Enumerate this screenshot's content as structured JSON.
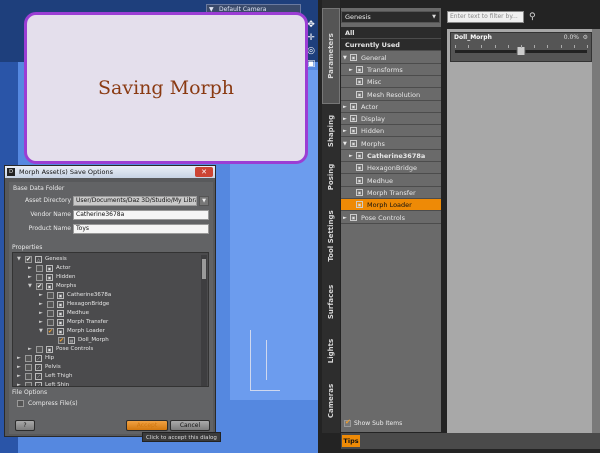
{
  "viewport": {
    "camera": "Default Camera"
  },
  "saving_popup": {
    "text": "Saving Morph"
  },
  "dialog": {
    "title": "Morph Asset(s) Save Options",
    "base_folder_label": "Base Data Folder",
    "asset_dir_label": "Asset Directory",
    "asset_dir_value": "User/Documents/Daz 3D/Studio/My Library",
    "vendor_label": "Vendor Name",
    "vendor_value": "Catherine3678a",
    "product_label": "Product Name",
    "product_value": "Toys",
    "properties_label": "Properties",
    "tree": [
      {
        "label": "Genesis",
        "indent": 0,
        "expand": "▼",
        "check": "chk",
        "icon": "figure"
      },
      {
        "label": "Actor",
        "indent": 1,
        "expand": "►",
        "check": "",
        "icon": "node"
      },
      {
        "label": "Hidden",
        "indent": 1,
        "expand": "►",
        "check": "",
        "icon": "node"
      },
      {
        "label": "Morphs",
        "indent": 1,
        "expand": "▼",
        "check": "chk",
        "icon": "node"
      },
      {
        "label": "Catherine3678a",
        "indent": 2,
        "expand": "►",
        "check": "",
        "icon": "node"
      },
      {
        "label": "HexagonBridge",
        "indent": 2,
        "expand": "►",
        "check": "",
        "icon": "node"
      },
      {
        "label": "Medhue",
        "indent": 2,
        "expand": "►",
        "check": "",
        "icon": "node"
      },
      {
        "label": "Morph Transfer",
        "indent": 2,
        "expand": "►",
        "check": "",
        "icon": "node"
      },
      {
        "label": "Morph Loader",
        "indent": 2,
        "expand": "▼",
        "check": "part",
        "icon": "node"
      },
      {
        "label": "Doll_Morph",
        "indent": 3,
        "expand": "",
        "check": "part",
        "icon": "morph"
      },
      {
        "label": "Pose Controls",
        "indent": 1,
        "expand": "►",
        "check": "",
        "icon": "node"
      },
      {
        "label": "Hip",
        "indent": 0,
        "expand": "►",
        "check": "",
        "icon": "bone"
      },
      {
        "label": "Pelvis",
        "indent": 0,
        "expand": "►",
        "check": "",
        "icon": "bone"
      },
      {
        "label": "Left Thigh",
        "indent": 0,
        "expand": "►",
        "check": "",
        "icon": "bone"
      },
      {
        "label": "Left Shin",
        "indent": 0,
        "expand": "►",
        "check": "",
        "icon": "bone"
      }
    ],
    "file_options_label": "File Options",
    "compress_label": "Compress File(s)",
    "help_label": "?",
    "accept_label": "Accept",
    "cancel_label": "Cancel",
    "tooltip": "Click to accept this dialog"
  },
  "side_tabs": [
    "Parameters",
    "Shaping",
    "Posing",
    "Tool Settings",
    "Surfaces",
    "Lights",
    "Cameras"
  ],
  "parameters": {
    "node_select": "Genesis",
    "filter_placeholder": "Enter text to filter by...",
    "categories": [
      {
        "label": "All",
        "style": "top",
        "icon": false,
        "indent": 0,
        "expand": ""
      },
      {
        "label": "Currently Used",
        "style": "top",
        "icon": false,
        "indent": 0,
        "expand": ""
      },
      {
        "label": "General",
        "style": "",
        "icon": true,
        "indent": 0,
        "expand": "▼"
      },
      {
        "label": "Transforms",
        "style": "",
        "icon": true,
        "indent": 1,
        "expand": "►"
      },
      {
        "label": "Misc",
        "style": "",
        "icon": true,
        "indent": 1,
        "expand": ""
      },
      {
        "label": "Mesh Resolution",
        "style": "",
        "icon": true,
        "indent": 1,
        "expand": ""
      },
      {
        "label": "Actor",
        "style": "",
        "icon": true,
        "indent": 0,
        "expand": "►"
      },
      {
        "label": "Display",
        "style": "",
        "icon": true,
        "indent": 0,
        "expand": "►"
      },
      {
        "label": "Hidden",
        "style": "",
        "icon": true,
        "indent": 0,
        "expand": "►"
      },
      {
        "label": "Morphs",
        "style": "",
        "icon": true,
        "indent": 0,
        "expand": "▼"
      },
      {
        "label": "Catherine3678a",
        "style": "bold",
        "icon": true,
        "indent": 1,
        "expand": "►"
      },
      {
        "label": "HexagonBridge",
        "style": "",
        "icon": true,
        "indent": 1,
        "expand": ""
      },
      {
        "label": "Medhue",
        "style": "",
        "icon": true,
        "indent": 1,
        "expand": ""
      },
      {
        "label": "Morph Transfer",
        "style": "",
        "icon": true,
        "indent": 1,
        "expand": ""
      },
      {
        "label": "Morph Loader",
        "style": "sel",
        "icon": true,
        "indent": 1,
        "expand": ""
      },
      {
        "label": "Pose Controls",
        "style": "",
        "icon": true,
        "indent": 0,
        "expand": "►"
      }
    ],
    "show_sub_items": "Show Sub Items",
    "tips_tab": "Tips",
    "slider": {
      "name": "Doll_Morph",
      "value_text": "0.0%",
      "value": 0.0,
      "min": -100,
      "max": 100
    }
  }
}
